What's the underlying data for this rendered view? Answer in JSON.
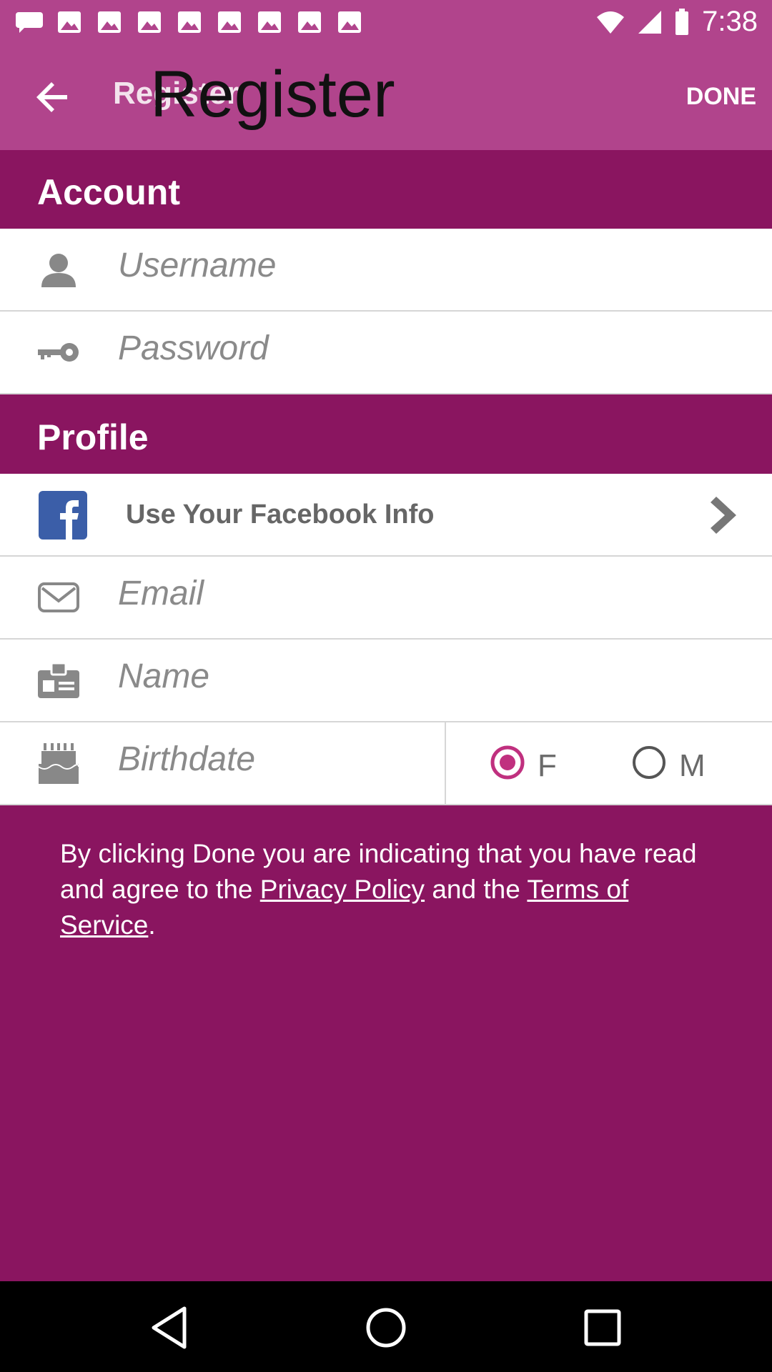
{
  "status_bar": {
    "time": "7:38",
    "notification_icons": [
      "notification-icon",
      "notification-icon",
      "notification-icon",
      "notification-icon",
      "notification-icon",
      "notification-icon",
      "notification-icon",
      "notification-icon",
      "notification-icon"
    ]
  },
  "toolbar": {
    "title_small": "Register",
    "title_large": "Register",
    "done_label": "DONE"
  },
  "account": {
    "header": "Account",
    "username_placeholder": "Username",
    "password_placeholder": "Password"
  },
  "profile": {
    "header": "Profile",
    "facebook_label": "Use Your Facebook Info",
    "email_placeholder": "Email",
    "name_placeholder": "Name",
    "birthdate_placeholder": "Birthdate",
    "gender": {
      "female": "F",
      "male": "M",
      "selected": "F"
    }
  },
  "terms": {
    "prefix": "By clicking Done you are indicating that you have read and agree to the ",
    "privacy_link": "Privacy Policy",
    "middle": " and the ",
    "tos_link": "Terms of Service",
    "suffix": "."
  },
  "colors": {
    "toolbar": "#b1448c",
    "primary": "#8a1560",
    "radio_selected": "#c0307f"
  }
}
